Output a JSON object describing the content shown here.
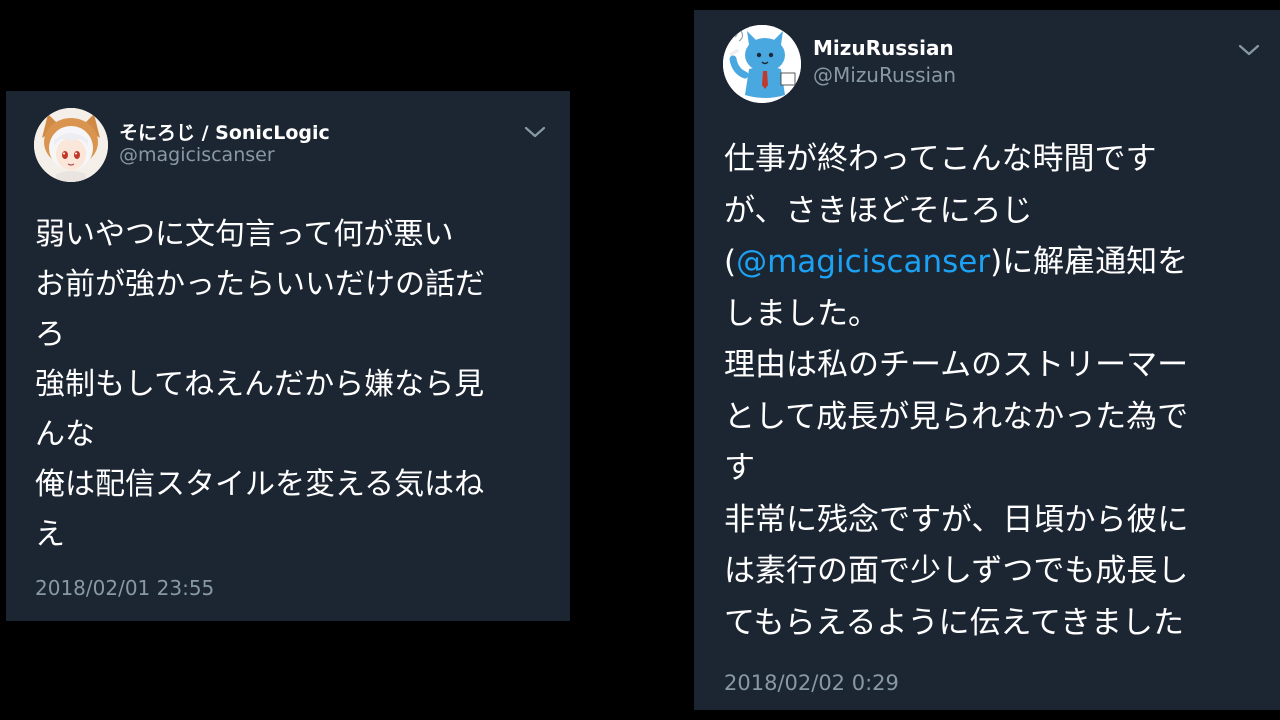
{
  "tweets": [
    {
      "display_name": "そにろじ / SonicLogic",
      "handle": "@magiciscanser",
      "lines": [
        "弱いやつに文句言って何が悪い",
        "お前が強かったらいいだけの話だ",
        "ろ",
        "強制もしてねえんだから嫌なら見",
        "んな",
        "俺は配信スタイルを変える気はね",
        "え"
      ],
      "timestamp": "2018/02/01 23:55",
      "avatar_icon": "anime-character-avatar-icon",
      "menu_icon": "chevron-down-icon"
    },
    {
      "display_name": "MizuRussian",
      "handle": "@MizuRussian",
      "lines": [
        "仕事が終わってこんな時間です",
        "が、さきほどそにろじ"
      ],
      "mention_line": {
        "prefix": "(",
        "mention": "@magiciscanser",
        "suffix": ")に解雇通知を"
      },
      "lines_after": [
        "しました。",
        "理由は私のチームのストリーマー",
        "として成長が見られなかった為で",
        "す",
        "非常に残念ですが、日頃から彼に",
        "は素行の面で少しずつでも成長し",
        "てもらえるように伝えてきました"
      ],
      "timestamp": "2018/02/02 0:29",
      "avatar_icon": "blue-cat-mascot-avatar-icon",
      "menu_icon": "chevron-down-icon"
    }
  ],
  "colors": {
    "background": "#000000",
    "card": "#1c2532",
    "text": "#ffffff",
    "secondary_text": "#8899a6",
    "link": "#1da1f2"
  }
}
